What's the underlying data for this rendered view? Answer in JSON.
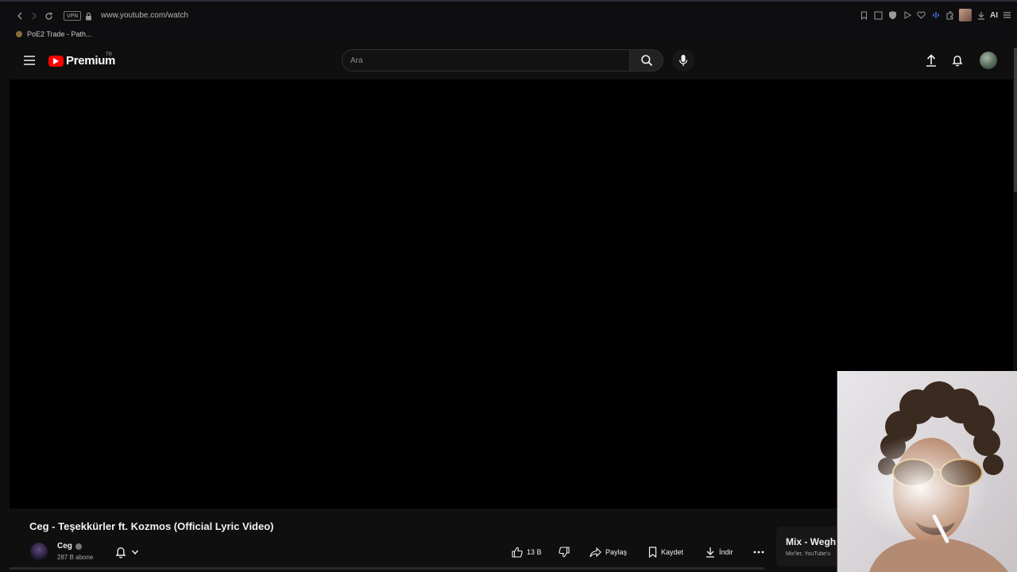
{
  "browser": {
    "url": "www.youtube.com/watch",
    "vpn_label": "VPN",
    "ai_label": "AI",
    "bookmarks": [
      {
        "label": "PoE2 Trade - Path..."
      }
    ]
  },
  "header": {
    "logo_text": "Premium",
    "country_code": "TR",
    "search_placeholder": "Ara"
  },
  "video": {
    "title": "Ceg - Teşekkürler ft. Kozmos (Official Lyric Video)",
    "channel": {
      "name": "Ceg",
      "subscribers": "287 B abone"
    },
    "actions": {
      "likes": "13 B",
      "share": "Paylaş",
      "save": "Kaydet",
      "download": "İndir"
    }
  },
  "sidebar": {
    "mix_title": "Mix - Wegh",
    "mix_subtitle": "Mix'ler, YouTube'u"
  },
  "colors": {
    "background": "#0f0f0f",
    "player": "#000000",
    "brand_red": "#ff0000",
    "text": "#f1f1f1",
    "muted": "#aaaaaa"
  }
}
